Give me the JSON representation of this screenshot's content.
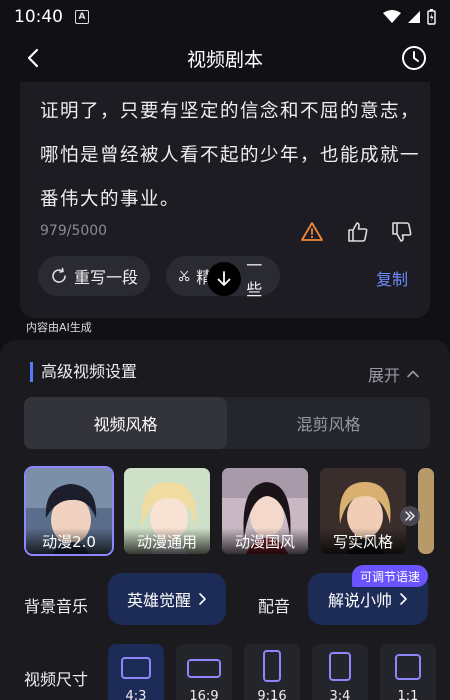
{
  "status": {
    "time": "10:40",
    "a_badge": "A"
  },
  "header": {
    "title": "视频剧本"
  },
  "script_card": {
    "paragraph": "证明了，只要有坚定的信念和不屈的意志，哪怕是曾经被人看不起的少年，也能成就一番伟大的事业。",
    "char_count": "979/5000",
    "rewrite_label": "重写一段",
    "trim_label": "精",
    "trim_label_tail": "一些",
    "copy_label": "复制"
  },
  "ai_note": "内容由AI生成",
  "advanced": {
    "title": "高级视频设置",
    "expand_label": "展开",
    "tabs": [
      {
        "label": "视频风格",
        "active": true
      },
      {
        "label": "混剪风格",
        "active": false
      }
    ],
    "styles": [
      {
        "label": "动漫2.0",
        "selected": true
      },
      {
        "label": "动漫通用",
        "selected": false
      },
      {
        "label": "动漫国风",
        "selected": false
      },
      {
        "label": "写实风格",
        "selected": false
      }
    ],
    "music_label": "背景音乐",
    "music_value": "英雄觉醒",
    "voice_label": "配音",
    "voice_value": "解说小帅",
    "voice_badge": "可调节语速",
    "size_label": "视频尺寸",
    "sizes": [
      {
        "ratio": "4:3",
        "active": true
      },
      {
        "ratio": "16:9",
        "active": false
      },
      {
        "ratio": "9:16",
        "active": false
      },
      {
        "ratio": "3:4",
        "active": false
      },
      {
        "ratio": "1:1",
        "active": false
      }
    ]
  },
  "colors": {
    "accent": "#6b8cff",
    "selected_border": "#8d86ff",
    "chip_bg": "#1d2b57",
    "badge": "#6a54ff",
    "warning": "#f0883a"
  }
}
